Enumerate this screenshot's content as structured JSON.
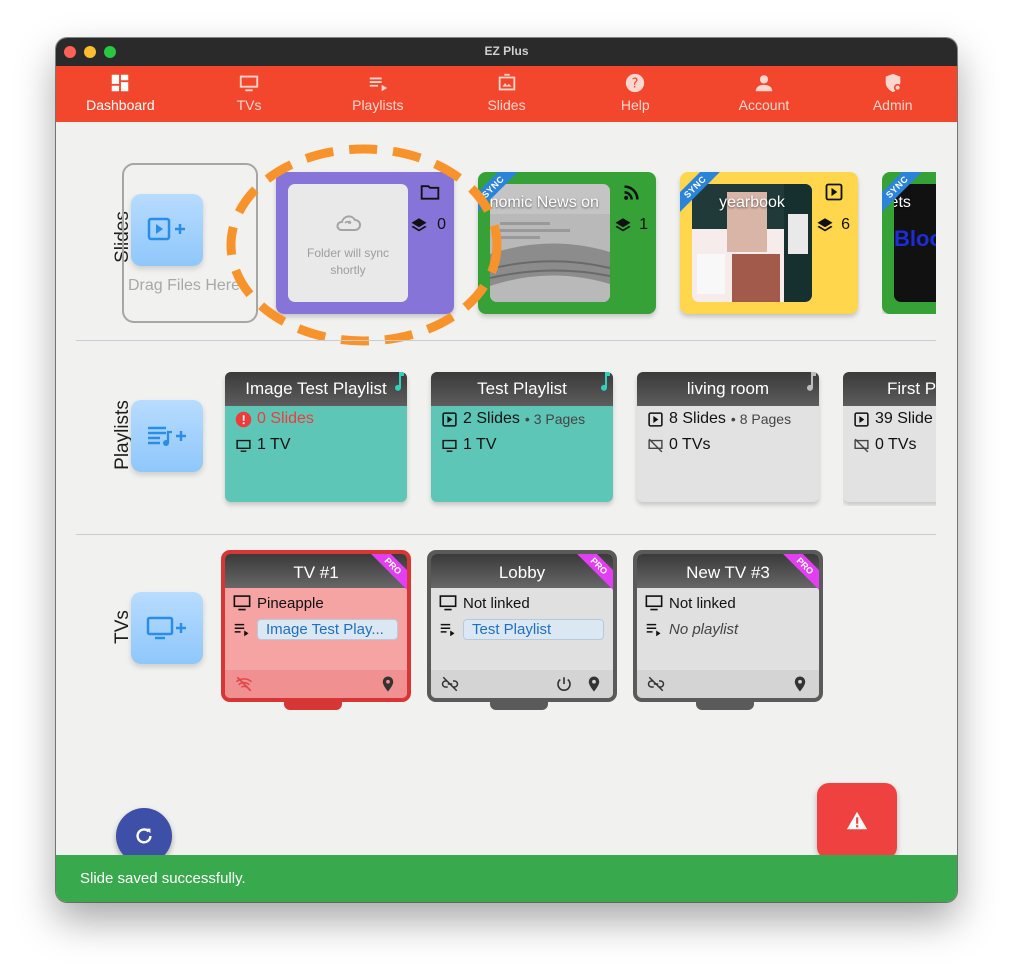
{
  "window": {
    "title": "EZ Plus"
  },
  "nav": {
    "items": [
      {
        "label": "Dashboard",
        "icon": "dashboard-icon",
        "active": true
      },
      {
        "label": "TVs",
        "icon": "tv-icon"
      },
      {
        "label": "Playlists",
        "icon": "playlist-icon"
      },
      {
        "label": "Slides",
        "icon": "slides-icon"
      },
      {
        "label": "Help",
        "icon": "help-icon"
      },
      {
        "label": "Account",
        "icon": "account-icon"
      },
      {
        "label": "Admin",
        "icon": "admin-shield-icon"
      }
    ]
  },
  "sections": {
    "slides": "Slides",
    "playlists": "Playlists",
    "tvs": "TVs"
  },
  "slides": {
    "drop_label": "Drag Files Here",
    "items": [
      {
        "type": "folder",
        "status": "Folder will sync shortly",
        "count": "0",
        "color": "#8774d8"
      },
      {
        "title": "Economic News on",
        "badge": "SYNC",
        "count": "1",
        "color": "#35a137",
        "icon": "rss-icon"
      },
      {
        "title": "yearbook",
        "badge": "SYNC",
        "count": "6",
        "color": "#ffd64c",
        "icon": "slideshow-icon"
      },
      {
        "title": "Markets",
        "badge": "SYNC",
        "color": "#35a137"
      }
    ]
  },
  "playlists": [
    {
      "title": "Image Test Playlist",
      "slides": "0 Slides",
      "tvs": "1 TV",
      "color": "#5ec6b7",
      "warning": true
    },
    {
      "title": "Test Playlist",
      "slides": "2 Slides",
      "pages": "3 Pages",
      "tvs": "1 TV",
      "color": "#5ec6b7"
    },
    {
      "title": "living room",
      "slides": "8 Slides",
      "pages": "8 Pages",
      "tvs": "0 TVs",
      "color": "#e2e2e2"
    },
    {
      "title": "First P",
      "slides": "39 Slide",
      "tvs": "0 TVs",
      "color": "#e2e2e2"
    }
  ],
  "tvs": [
    {
      "name": "TV #1",
      "device": "Pineapple",
      "playlist": "Image Test Play...",
      "badge": "PRO",
      "color": "#f5a3a3",
      "border": "#d83535"
    },
    {
      "name": "Lobby",
      "device": "Not linked",
      "playlist": "Test Playlist",
      "badge": "PRO",
      "color": "#e0e0e0",
      "border": "#5a5a5a"
    },
    {
      "name": "New TV #3",
      "device": "Not linked",
      "playlist": "No playlist",
      "badge": "PRO",
      "color": "#e0e0e0",
      "border": "#5a5a5a"
    }
  ],
  "snackbar": {
    "message": "Slide saved successfully."
  },
  "colors": {
    "brand": "#f2462d",
    "success": "#39a94d",
    "alert": "#f04141",
    "refresh": "#3e4fa8"
  }
}
